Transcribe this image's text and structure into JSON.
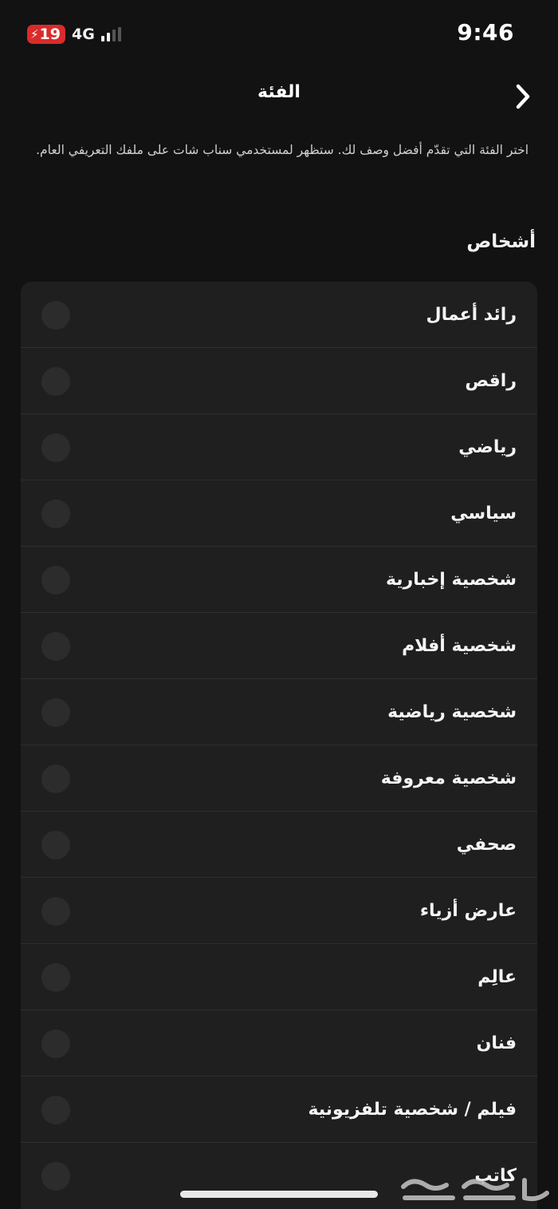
{
  "status_bar": {
    "battery_level": "19",
    "network": "4G",
    "time": "9:46"
  },
  "header": {
    "title": "الفئة",
    "back_icon": "chevron-right-icon"
  },
  "description": "اختر الفئة التي تقدّم أفضل وصف لك. ستظهر لمستخدمي سناب شات على ملفك التعريفي العام.",
  "section": {
    "title": "أشخاص"
  },
  "categories": [
    {
      "label": "رائد أعمال",
      "selected": false
    },
    {
      "label": "راقص",
      "selected": false
    },
    {
      "label": "رياضي",
      "selected": false
    },
    {
      "label": "سياسي",
      "selected": false
    },
    {
      "label": "شخصية إخبارية",
      "selected": false
    },
    {
      "label": "شخصية أفلام",
      "selected": false
    },
    {
      "label": "شخصية رياضية",
      "selected": false
    },
    {
      "label": "شخصية معروفة",
      "selected": false
    },
    {
      "label": "صحفي",
      "selected": false
    },
    {
      "label": "عارض أزياء",
      "selected": false
    },
    {
      "label": "عالِم",
      "selected": false
    },
    {
      "label": "فنان",
      "selected": false
    },
    {
      "label": "فيلم / شخصية تلفزيونية",
      "selected": false
    },
    {
      "label": "كاتب",
      "selected": false
    }
  ],
  "watermark_text": "حراج",
  "colors": {
    "background": "#121212",
    "list_background": "#1f1f1f",
    "battery_low": "#d92b2b"
  }
}
